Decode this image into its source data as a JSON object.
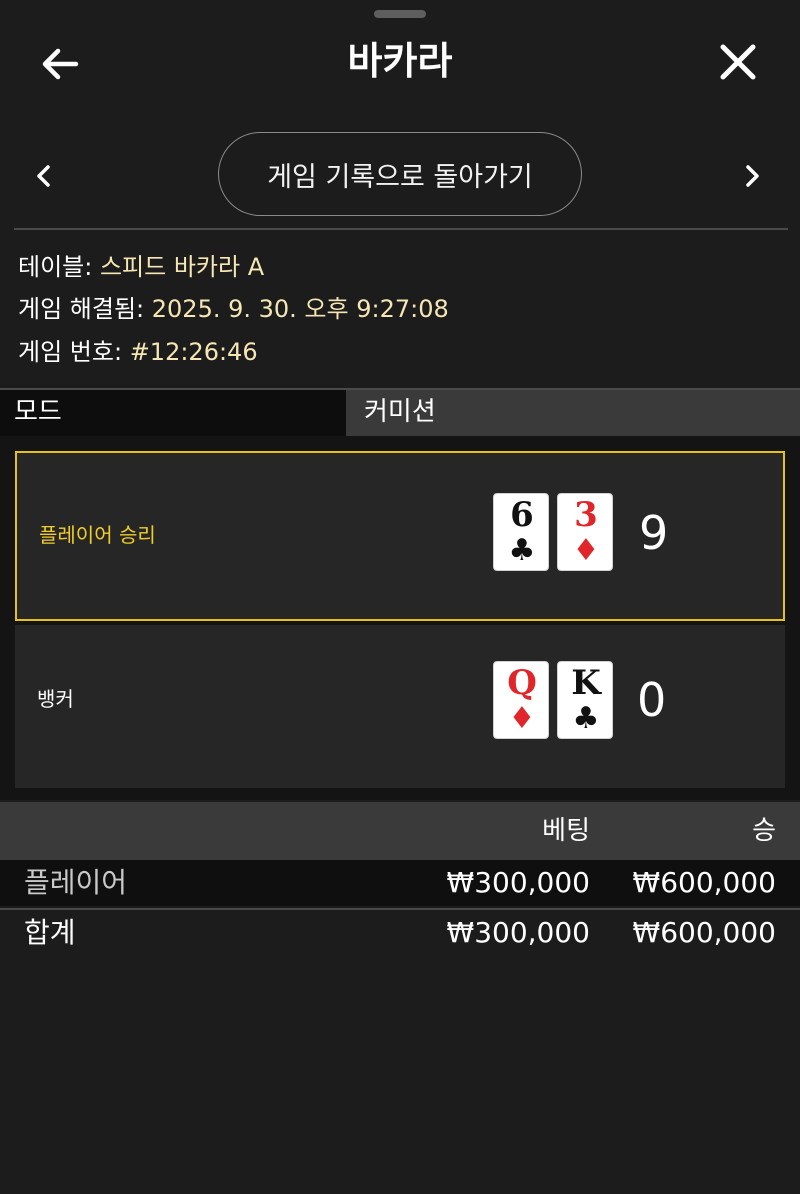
{
  "header": {
    "title": "바카라"
  },
  "nav": {
    "back_to_history_label": "게임 기록으로 돌아가기"
  },
  "info": {
    "table_label": "테이블:",
    "table_value": "스피드 바카라 A",
    "resolved_label": "게임 해결됨:",
    "resolved_value": "2025. 9. 30. 오후 9:27:08",
    "game_no_label": "게임 번호:",
    "game_no_value": "#12:26:46"
  },
  "mode": {
    "label": "모드",
    "value": "커미션"
  },
  "hands": {
    "player": {
      "label": "플레이어 승리",
      "cards": [
        {
          "rank": "6",
          "suit": "♣",
          "color": "black"
        },
        {
          "rank": "3",
          "suit": "♦",
          "color": "red"
        }
      ],
      "score": "9"
    },
    "banker": {
      "label": "뱅커",
      "cards": [
        {
          "rank": "Q",
          "suit": "♦",
          "color": "red"
        },
        {
          "rank": "K",
          "suit": "♣",
          "color": "black"
        }
      ],
      "score": "0"
    }
  },
  "bets_table": {
    "headers": {
      "bet": "베팅",
      "win": "승"
    },
    "rows": [
      {
        "name": "플레이어",
        "bet": "₩300,000",
        "win": "₩600,000"
      }
    ],
    "total": {
      "name": "합계",
      "bet": "₩300,000",
      "win": "₩600,000"
    }
  },
  "colors": {
    "accent": "#e4c11c",
    "value_text": "#f5e6b4",
    "red_suit": "#e0252b"
  }
}
